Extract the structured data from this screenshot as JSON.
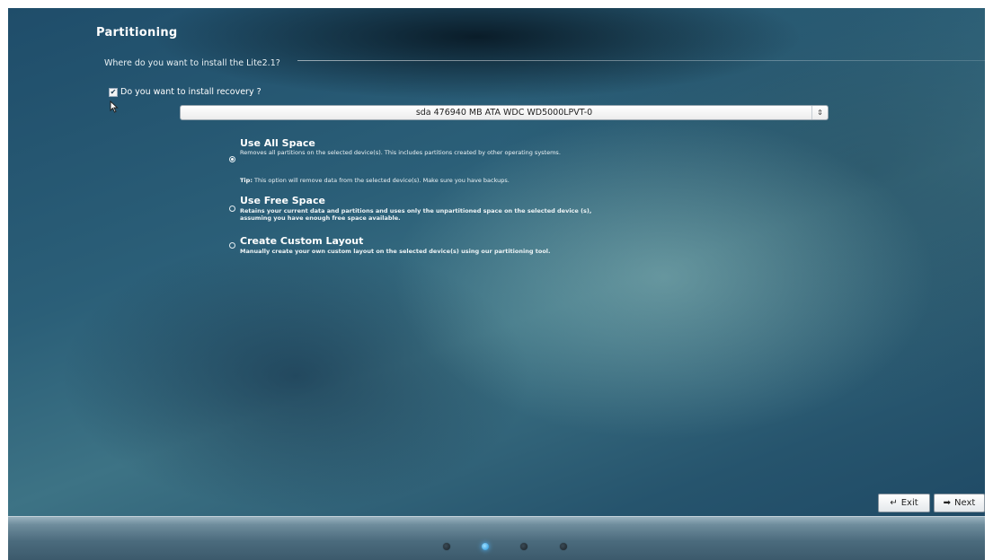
{
  "page": {
    "title": "Partitioning",
    "question": "Where do you want to install the Lite2.1?"
  },
  "recovery": {
    "label": "Do you want to install recovery ?",
    "checked": true
  },
  "device_select": {
    "selected": "sda  476940 MB ATA WDC WD5000LPVT-0"
  },
  "options": [
    {
      "title": "Use All Space",
      "description": "Removes all partitions on the selected device(s). This includes partitions created by other operating systems.",
      "selected": true
    },
    {
      "title": "Use Free Space",
      "description": "Retains your current data and partitions and uses only the unpartitioned space on the selected device (s), assuming you have enough free space available.",
      "selected": false
    },
    {
      "title": "Create Custom Layout",
      "description": "Manually create your own custom layout on the selected device(s) using our partitioning tool.",
      "selected": false
    }
  ],
  "tip": {
    "label": "Tip:",
    "text": " This option will remove data from the selected device(s). Make sure you have backups."
  },
  "buttons": {
    "exit": "Exit",
    "next": "Next"
  },
  "progress": {
    "total_steps": 4,
    "current_step": 2
  },
  "colors": {
    "background": "#2b5f78",
    "active_step": "#1f8fd8"
  }
}
